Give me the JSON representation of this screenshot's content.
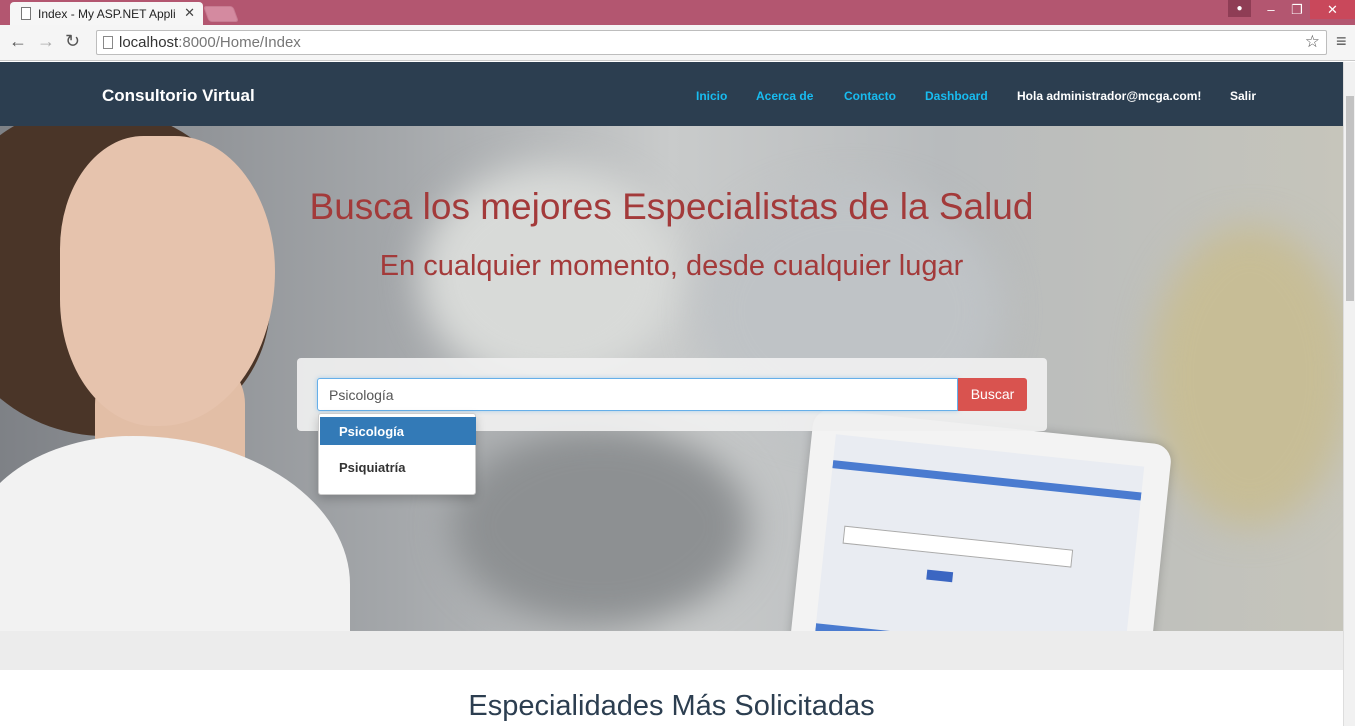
{
  "browser": {
    "tab_title": "Index - My ASP.NET Appli",
    "tab_close": "✕",
    "url_host": "localhost",
    "url_path": ":8000/Home/Index",
    "window_controls": {
      "minimize": "–",
      "restore": "❐",
      "close": "✕"
    }
  },
  "navbar": {
    "brand": "Consultorio Virtual",
    "links": [
      "Inicio",
      "Acerca de",
      "Contacto",
      "Dashboard"
    ],
    "greeting": "Hola administrador@mcga.com!",
    "logout": "Salir"
  },
  "hero": {
    "title": "Busca los mejores Especialistas de la Salud",
    "subtitle": "En cualquier momento, desde cualquier lugar"
  },
  "search": {
    "value": "Psicología",
    "button_label": "Buscar",
    "suggestions": [
      "Psicología",
      "Psiquiatría"
    ],
    "selected_index": 0
  },
  "section": {
    "title": "Especialidades Más Solicitadas"
  },
  "colors": {
    "navbar_bg": "#2c3e50",
    "link": "#18bcf0",
    "hero_text": "#a33a3a",
    "search_button": "#d9534f",
    "suggestion_active": "#337ab7",
    "titlebar": "#b35670"
  }
}
